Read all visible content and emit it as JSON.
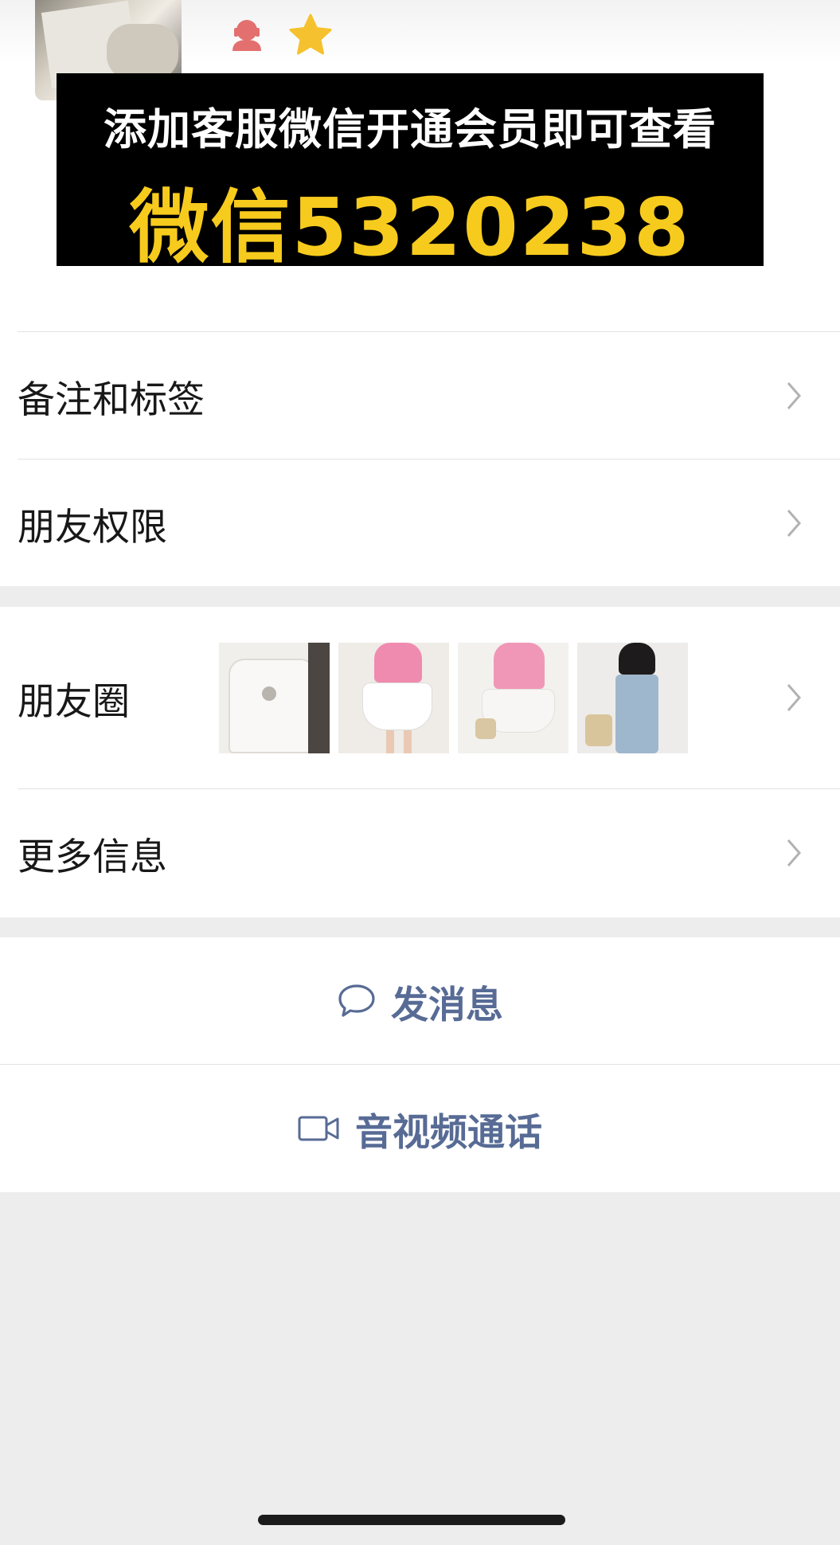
{
  "ad": {
    "line1": "添加客服微信开通会员即可查看",
    "line2": "微信5320238",
    "text_color": "#ffffff",
    "highlight_color": "#f7cb1d"
  },
  "profile": {
    "icons": [
      "customer-service-icon",
      "star-icon"
    ]
  },
  "menu": {
    "remarks_tags": "备注和标签",
    "friend_permissions": "朋友权限",
    "moments": "朋友圈",
    "more_info": "更多信息"
  },
  "moments": {
    "thumbnails": [
      "moment-photo-1",
      "moment-photo-2",
      "moment-photo-3",
      "moment-photo-4"
    ]
  },
  "actions": {
    "send_message": "发消息",
    "voice_video_call": "音视频通话"
  },
  "colors": {
    "link": "#576b95",
    "background": "#ededed",
    "star": "#f5c12e",
    "cs_icon": "#e46f6f"
  }
}
